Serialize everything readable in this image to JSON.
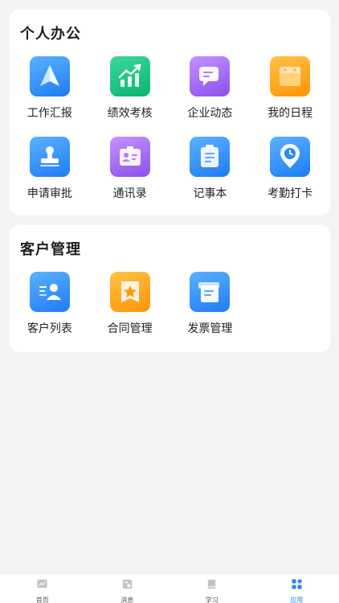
{
  "sections": [
    {
      "title": "个人办公",
      "items": [
        {
          "label": "工作汇报",
          "icon": "paper-plane-icon",
          "color": "blue"
        },
        {
          "label": "绩效考核",
          "icon": "chart-up-icon",
          "color": "green"
        },
        {
          "label": "企业动态",
          "icon": "chat-bubble-icon",
          "color": "purple"
        },
        {
          "label": "我的日程",
          "icon": "calendar-icon",
          "color": "orange"
        },
        {
          "label": "申请审批",
          "icon": "stamp-icon",
          "color": "blue"
        },
        {
          "label": "通讯录",
          "icon": "contact-card-icon",
          "color": "purple"
        },
        {
          "label": "记事本",
          "icon": "notepad-icon",
          "color": "blue"
        },
        {
          "label": "考勤打卡",
          "icon": "clock-pin-icon",
          "color": "blue"
        }
      ]
    },
    {
      "title": "客户管理",
      "items": [
        {
          "label": "客户列表",
          "icon": "customer-list-icon",
          "color": "blue"
        },
        {
          "label": "合同管理",
          "icon": "contract-star-icon",
          "color": "orange"
        },
        {
          "label": "发票管理",
          "icon": "invoice-icon",
          "color": "blue"
        }
      ]
    }
  ],
  "tabbar": [
    {
      "label": "首页",
      "icon": "home-chart-icon",
      "active": false
    },
    {
      "label": "消息",
      "icon": "message-icon",
      "active": false
    },
    {
      "label": "学习",
      "icon": "book-icon",
      "active": false
    },
    {
      "label": "应用",
      "icon": "apps-grid-icon",
      "active": true
    }
  ],
  "colors": {
    "accent": "#2f86f6",
    "background": "#f4f4f5"
  }
}
